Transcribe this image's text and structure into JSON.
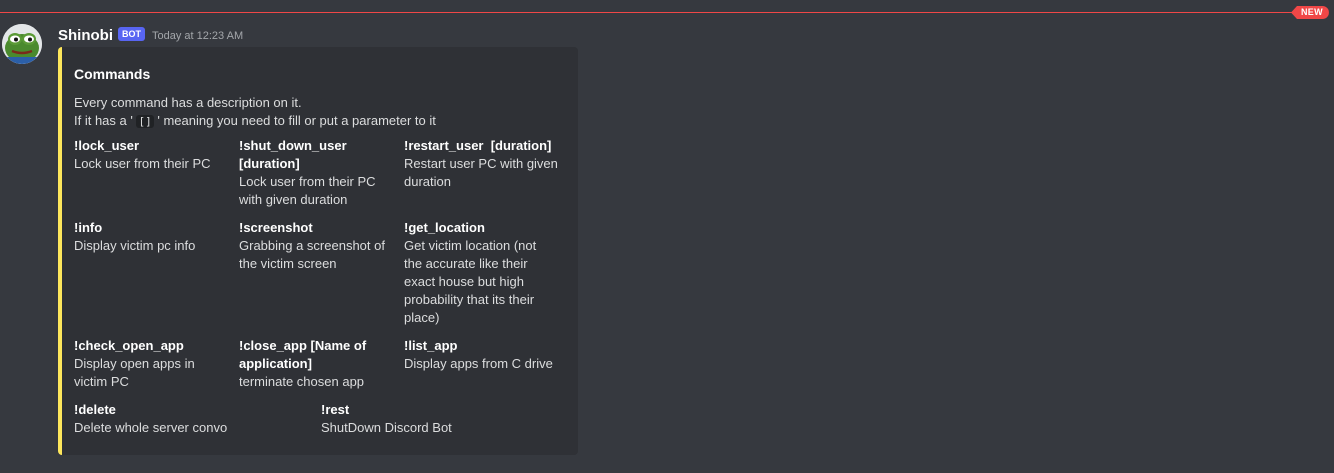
{
  "divider": {
    "badge": "NEW"
  },
  "message": {
    "username": "Shinobi",
    "bot_tag": "BOT",
    "timestamp": "Today at 12:23 AM",
    "avatar_icon": "frog-avatar-icon"
  },
  "embed": {
    "accent_color": "#fee75c",
    "title": "Commands",
    "description_line1": "Every command has a description on it.",
    "description_line2_before": "If it has a '",
    "description_line2_code": "[]",
    "description_line2_after": "' meaning you need to fill or put a parameter to it",
    "fields": [
      {
        "name": "!lock_user",
        "value": "Lock user from their PC"
      },
      {
        "name": "!shut_down_user [duration]",
        "value": "Lock user from their PC with given duration"
      },
      {
        "name": "!restart_user  [duration]",
        "value": "Restart user PC with given duration"
      },
      {
        "name": "!info",
        "value": "Display victim pc info"
      },
      {
        "name": "!screenshot",
        "value": "Grabbing a screenshot of the victim screen"
      },
      {
        "name": "!get_location",
        "value": "Get victim location (not the accurate like their exact house but high probability that its their place)"
      },
      {
        "name": "!check_open_app",
        "value": "Display open apps in victim PC"
      },
      {
        "name": "!close_app [Name of application]",
        "value": "terminate chosen app"
      },
      {
        "name": "!list_app",
        "value": "Display apps from C drive"
      },
      {
        "name": "!delete",
        "value": "Delete whole server convo"
      },
      {
        "name": "!rest",
        "value": "ShutDown Discord Bot"
      }
    ]
  }
}
